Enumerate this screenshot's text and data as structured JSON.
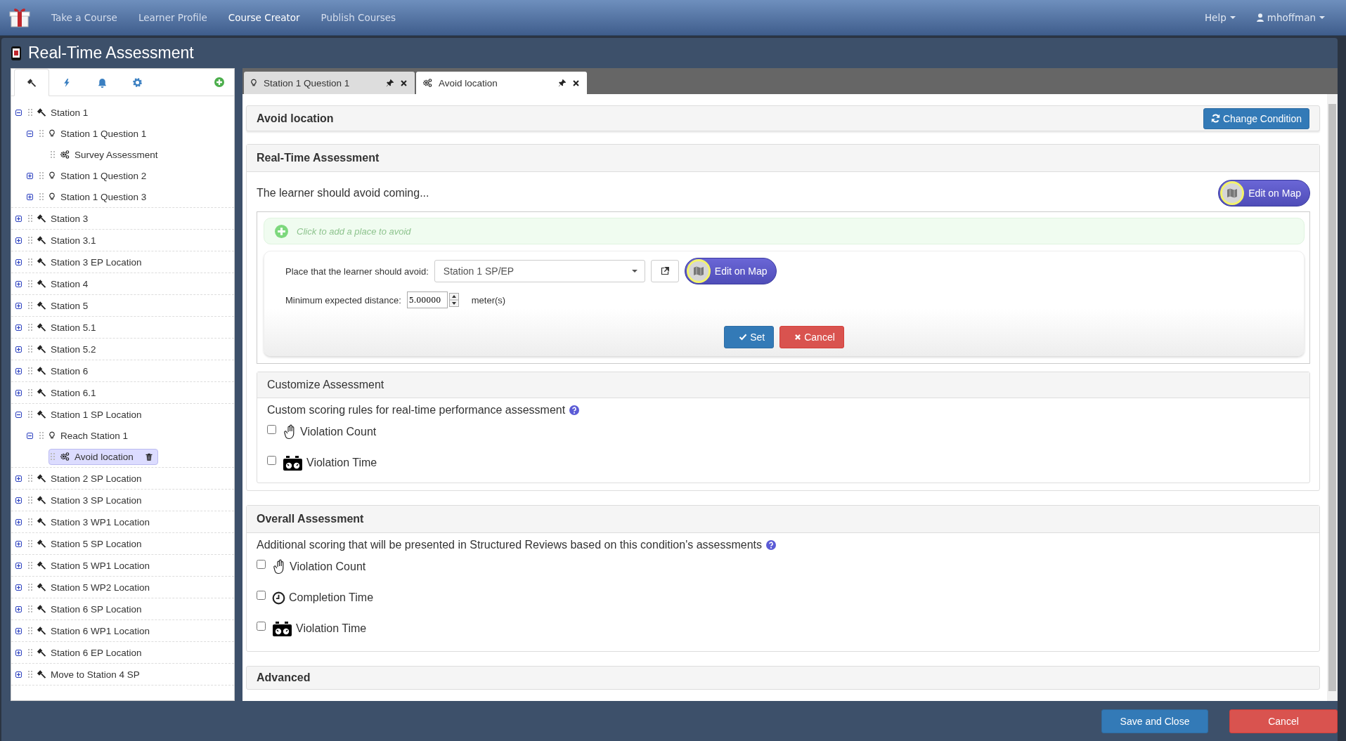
{
  "navbar": {
    "links": [
      {
        "label": "Take a Course",
        "selected": false
      },
      {
        "label": "Learner Profile",
        "selected": false
      },
      {
        "label": "Course Creator",
        "selected": true
      },
      {
        "label": "Publish Courses",
        "selected": false
      }
    ],
    "help": "Help",
    "user": "mhoffman"
  },
  "dialog": {
    "title": "Real-Time Assessment"
  },
  "sidebar": {
    "tabs": [
      {
        "kind": "build",
        "selected": true
      },
      {
        "kind": "trigger",
        "selected": false
      },
      {
        "kind": "alert",
        "selected": false
      },
      {
        "kind": "settings",
        "selected": false
      }
    ],
    "tree": [
      {
        "label": "Station 1",
        "kind": "station",
        "expanded": true,
        "selected": false,
        "children": [
          {
            "label": "Station 1 Question 1",
            "kind": "question",
            "expanded": true,
            "selected": false,
            "children": [
              {
                "label": "Survey Assessment",
                "kind": "condition",
                "selected": false
              }
            ]
          },
          {
            "label": "Station 1 Question 2",
            "kind": "question",
            "expanded": false,
            "selected": false
          },
          {
            "label": "Station 1 Question 3",
            "kind": "question",
            "expanded": false,
            "selected": false
          }
        ]
      },
      {
        "label": "Station 3",
        "kind": "station",
        "expanded": false,
        "selected": false
      },
      {
        "label": "Station 3.1",
        "kind": "station",
        "expanded": false,
        "selected": false
      },
      {
        "label": "Station 3 EP Location",
        "kind": "station",
        "expanded": false,
        "selected": false
      },
      {
        "label": "Station 4",
        "kind": "station",
        "expanded": false,
        "selected": false
      },
      {
        "label": "Station 5",
        "kind": "station",
        "expanded": false,
        "selected": false
      },
      {
        "label": "Station 5.1",
        "kind": "station",
        "expanded": false,
        "selected": false
      },
      {
        "label": "Station 5.2",
        "kind": "station",
        "expanded": false,
        "selected": false
      },
      {
        "label": "Station 6",
        "kind": "station",
        "expanded": false,
        "selected": false
      },
      {
        "label": "Station 6.1",
        "kind": "station",
        "expanded": false,
        "selected": false
      },
      {
        "label": "Station 1 SP Location",
        "kind": "station",
        "expanded": true,
        "selected": false,
        "children": [
          {
            "label": "Reach Station 1",
            "kind": "question",
            "expanded": true,
            "selected": false,
            "children": [
              {
                "label": "Avoid location",
                "kind": "condition",
                "selected": true
              }
            ]
          }
        ]
      },
      {
        "label": "Station 2 SP Location",
        "kind": "station",
        "expanded": false,
        "selected": false
      },
      {
        "label": "Station 3 SP Location",
        "kind": "station",
        "expanded": false,
        "selected": false
      },
      {
        "label": "Station 3 WP1 Location",
        "kind": "station",
        "expanded": false,
        "selected": false
      },
      {
        "label": "Station 5 SP Location",
        "kind": "station",
        "expanded": false,
        "selected": false
      },
      {
        "label": "Station 5 WP1 Location",
        "kind": "station",
        "expanded": false,
        "selected": false
      },
      {
        "label": "Station 5 WP2 Location",
        "kind": "station",
        "expanded": false,
        "selected": false
      },
      {
        "label": "Station 6 SP Location",
        "kind": "station",
        "expanded": false,
        "selected": false
      },
      {
        "label": "Station 6 WP1 Location",
        "kind": "station",
        "expanded": false,
        "selected": false
      },
      {
        "label": "Station 6 EP Location",
        "kind": "station",
        "expanded": false,
        "selected": false
      },
      {
        "label": "Move to Station 4 SP",
        "kind": "station",
        "expanded": false,
        "selected": false
      }
    ]
  },
  "editor_tabs": [
    {
      "label": "Station 1 Question 1",
      "kind": "question",
      "selected": false
    },
    {
      "label": "Avoid location",
      "kind": "condition",
      "selected": true
    }
  ],
  "condition": {
    "title": "Avoid location",
    "change_button": "Change Condition"
  },
  "realtime": {
    "title": "Real-Time Assessment",
    "prompt": "The learner should avoid coming...",
    "map_button": "Edit on Map",
    "add_hint": "Click to add a place to avoid",
    "place_label": "Place that the learner should avoid:",
    "place_value": "Station 1 SP/EP",
    "place_map_button": "Edit on Map",
    "distance_label": "Minimum expected distance:",
    "distance_value": "5.00000",
    "distance_unit": "meter(s)",
    "set_button": "Set",
    "cancel_button": "Cancel",
    "customize": {
      "title": "Customize Assessment",
      "description": "Custom scoring rules for real-time performance assessment",
      "options": [
        {
          "label": "Violation Count",
          "kind": "count",
          "checked": false
        },
        {
          "label": "Violation Time",
          "kind": "time",
          "checked": false
        }
      ]
    }
  },
  "overall": {
    "title": "Overall Assessment",
    "description": "Additional scoring that will be presented in Structured Reviews based on this condition's assessments",
    "options": [
      {
        "label": "Violation Count",
        "kind": "count",
        "checked": false
      },
      {
        "label": "Completion Time",
        "kind": "completion",
        "checked": false
      },
      {
        "label": "Violation Time",
        "kind": "time",
        "checked": false
      }
    ]
  },
  "advanced": {
    "title": "Advanced"
  },
  "footer": {
    "save": "Save and Close",
    "cancel": "Cancel"
  }
}
